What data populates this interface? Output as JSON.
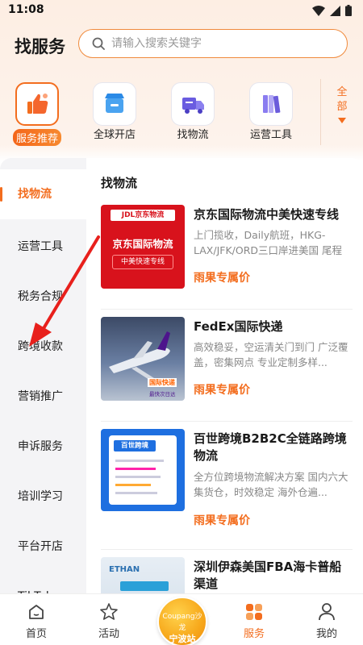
{
  "status_bar": {
    "time": "11:08"
  },
  "header": {
    "title": "找服务",
    "search_placeholder": "请输入搜索关键字"
  },
  "categories": [
    {
      "label": "服务推荐",
      "icon": "thumbs-up-icon",
      "active": true
    },
    {
      "label": "全球开店",
      "icon": "store-icon"
    },
    {
      "label": "找物流",
      "icon": "truck-icon"
    },
    {
      "label": "运营工具",
      "icon": "books-icon"
    }
  ],
  "all_button": {
    "line1": "全",
    "line2": "部"
  },
  "sidebar": {
    "items": [
      {
        "label": "找物流",
        "active": true
      },
      {
        "label": "运营工具"
      },
      {
        "label": "税务合规"
      },
      {
        "label": "跨境收款"
      },
      {
        "label": "营销推广"
      },
      {
        "label": "申诉服务"
      },
      {
        "label": "培训学习"
      },
      {
        "label": "平台开店"
      },
      {
        "label": "TikTok"
      }
    ]
  },
  "section": {
    "title": "找物流"
  },
  "cards": [
    {
      "title": "京东国际物流中美快速专线",
      "desc": "上门揽收，Daily航班，HKG-LAX/JFK/ORD三口岸进美国 尾程预...",
      "tag": "雨果专属价",
      "thumb": {
        "logo": "JDL京东物流",
        "headline": "京东国际物流",
        "sub": "中美快速专线"
      }
    },
    {
      "title": "FedEx国际快递",
      "desc": "高效稳妥，空运清关门到门 广泛覆盖，密集网点 专业定制多样...",
      "tag": "雨果专属价",
      "thumb": {
        "badge": "国际快递",
        "sub": "最快次日达"
      }
    },
    {
      "title": "百世跨境B2B2C全链路跨境物流",
      "desc": "全方位跨境物流解决方案 国内六大集货仓，时效稳定 海外仓遍...",
      "tag": "雨果专属价",
      "thumb": {
        "headline": "百世跨境"
      }
    },
    {
      "title": "深圳伊森美国FBA海卡普船渠道",
      "desc": "",
      "tag": "",
      "thumb": {
        "logo": "ETHAN"
      }
    }
  ],
  "tabbar": {
    "items": [
      {
        "label": "首页",
        "icon": "home-icon"
      },
      {
        "label": "活动",
        "icon": "star-icon"
      },
      {
        "label": "服务",
        "icon": "grid-icon",
        "active": true
      },
      {
        "label": "我的",
        "icon": "user-icon"
      }
    ],
    "center": {
      "line1": "Coupang沙龙",
      "line2": "宁波站"
    }
  },
  "colors": {
    "accent": "#f36d1e",
    "search_border": "#f08a3c",
    "sidebar_bg": "#f4f4f6"
  }
}
